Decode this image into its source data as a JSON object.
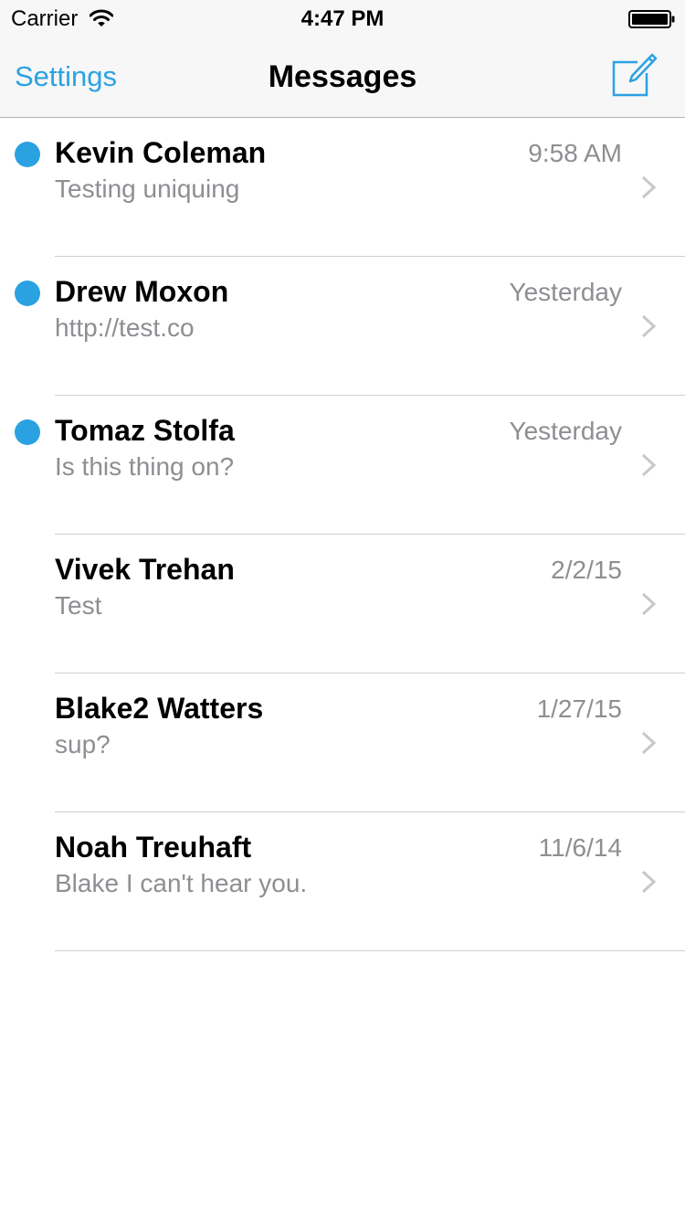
{
  "status_bar": {
    "carrier": "Carrier",
    "time": "4:47 PM",
    "icons": [
      "wifi-icon",
      "battery-icon"
    ]
  },
  "nav": {
    "left_button": "Settings",
    "title": "Messages",
    "right_icon": "compose-icon"
  },
  "colors": {
    "accent": "#2aa2e2",
    "secondary_text": "#8e8e93",
    "divider": "#cfcfcf",
    "nav_background": "#f7f7f7"
  },
  "messages": [
    {
      "name": "Kevin Coleman",
      "preview": "Testing uniquing",
      "date": "9:58 AM",
      "unread": true
    },
    {
      "name": "Drew Moxon",
      "preview": "http://test.co",
      "date": "Yesterday",
      "unread": true
    },
    {
      "name": "Tomaz Stolfa",
      "preview": "Is this thing on?",
      "date": "Yesterday",
      "unread": true
    },
    {
      "name": "Vivek Trehan",
      "preview": "Test",
      "date": "2/2/15",
      "unread": false
    },
    {
      "name": "Blake2 Watters",
      "preview": "sup?",
      "date": "1/27/15",
      "unread": false
    },
    {
      "name": "Noah Treuhaft",
      "preview": "Blake I can't hear you.",
      "date": "11/6/14",
      "unread": false
    }
  ]
}
